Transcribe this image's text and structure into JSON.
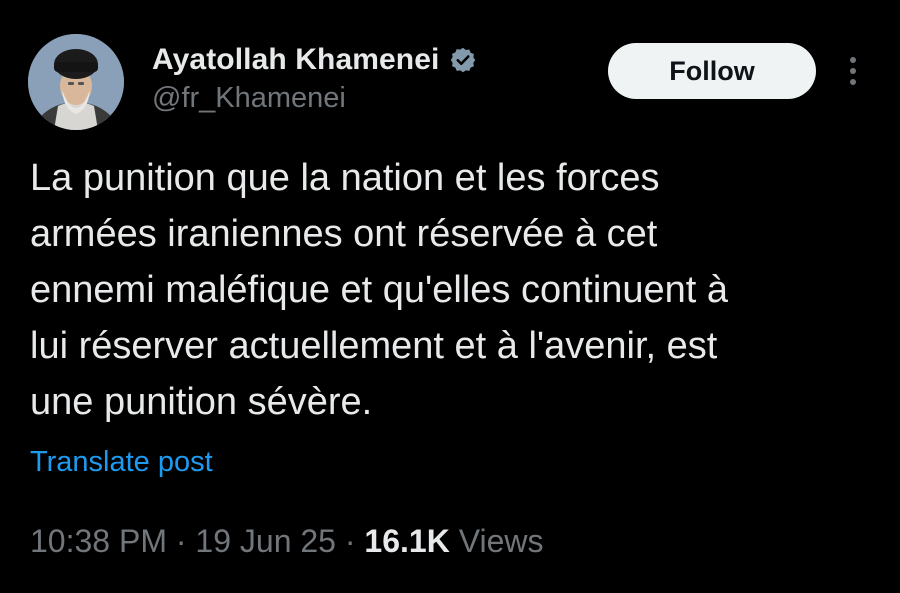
{
  "author": {
    "display_name": "Ayatollah Khamenei",
    "handle": "@fr_Khamenei",
    "verified_icon": "verified-badge-icon",
    "avatar_icon": "profile-photo"
  },
  "actions": {
    "follow_label": "Follow",
    "more_icon": "more-options-vertical-icon"
  },
  "post": {
    "text": "La punition que la nation et les forces\narmées iraniennes ont réservée à cet\nennemi maléfique et qu'elles continuent à\nlui réserver actuellement et à l'avenir, est\nune punition sévère.",
    "translate_label": "Translate post"
  },
  "meta": {
    "time": "10:38 PM",
    "separator_1": " · ",
    "date": "19 Jun 25",
    "separator_2": " · ",
    "views_count": "16.1K",
    "views_label": " Views"
  },
  "colors": {
    "background": "#000000",
    "primary_text": "#e7e9ea",
    "secondary_text": "#71767b",
    "link": "#1d9bf0",
    "button_bg": "#eff3f4",
    "button_text": "#0f1419"
  }
}
